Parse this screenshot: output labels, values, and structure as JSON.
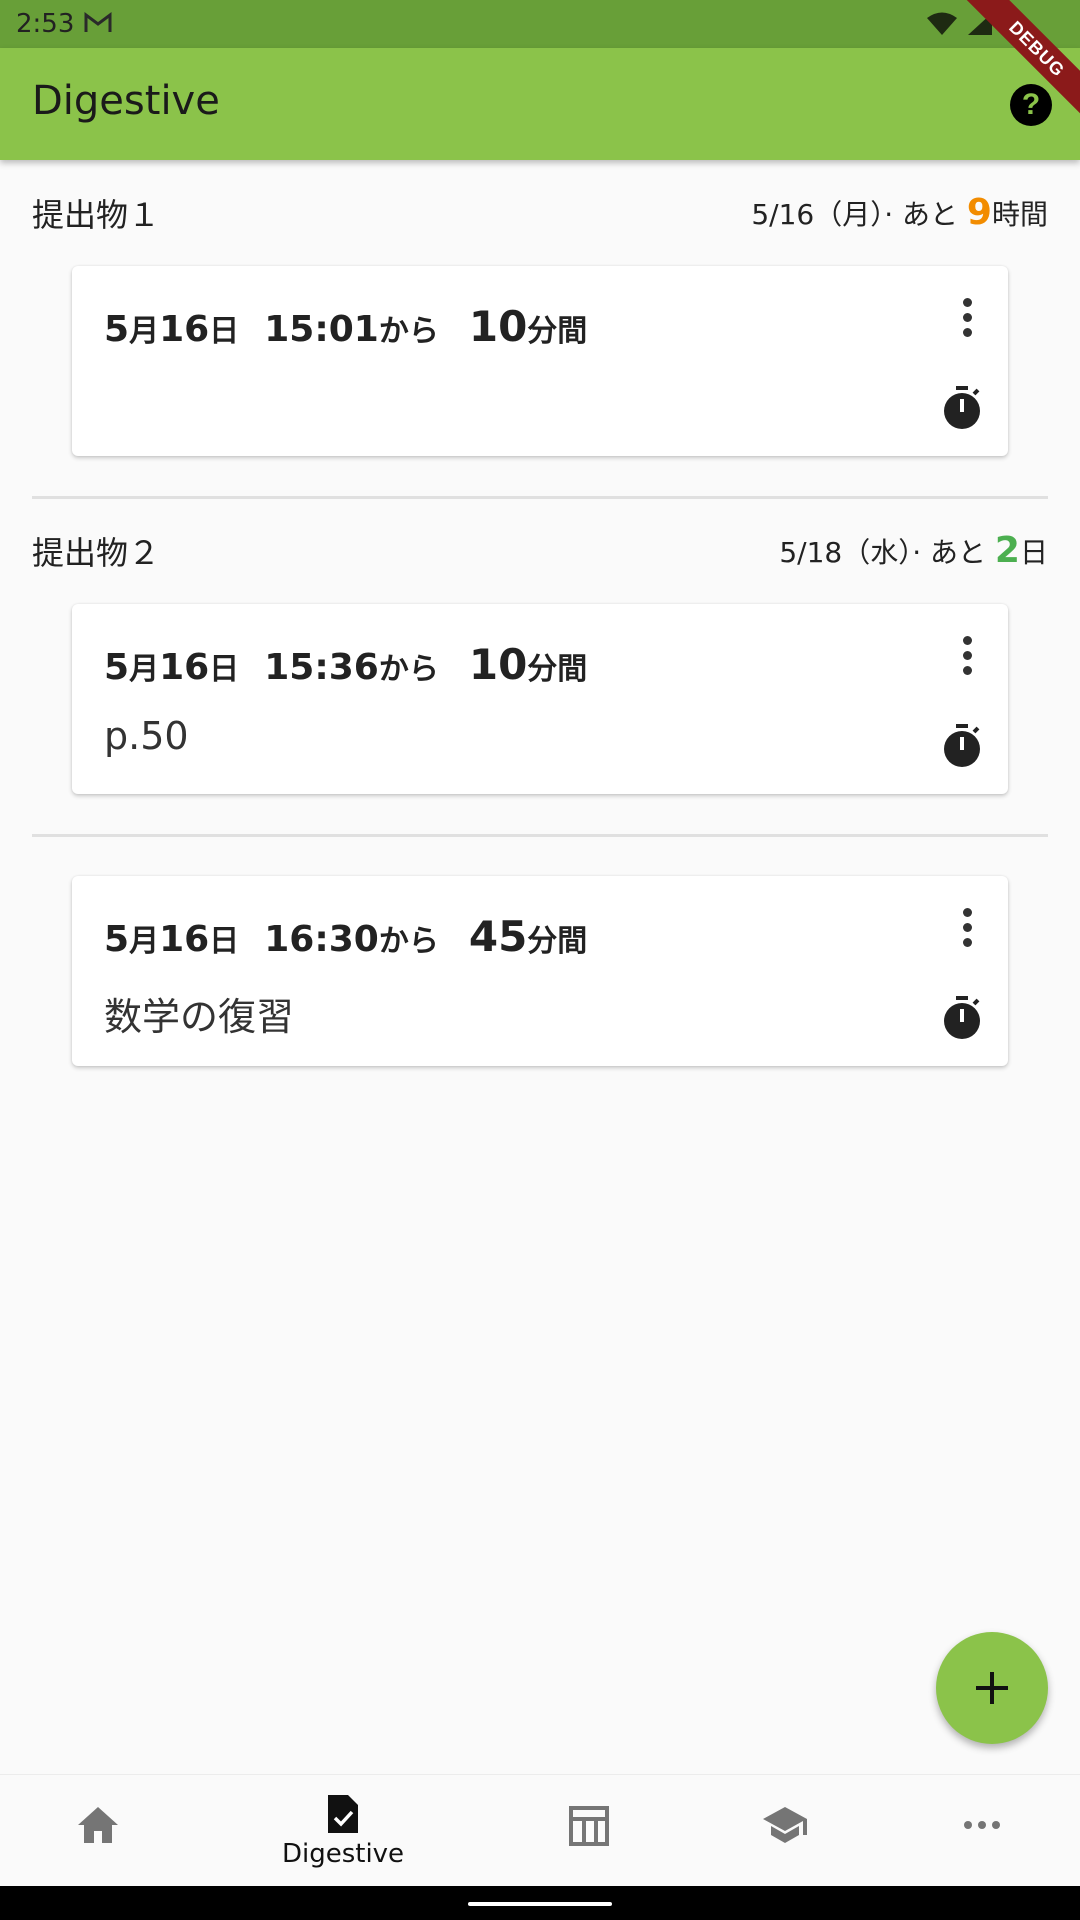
{
  "status_bar": {
    "time": "2:53"
  },
  "app_bar": {
    "title": "Digestive",
    "debug_label": "DEBUG"
  },
  "sections": [
    {
      "title": "提出物１",
      "due_prefix": "5/16（月）· あと ",
      "due_number": "9",
      "due_suffix": "時間",
      "due_color": "#f28c00"
    },
    {
      "title": "提出物２",
      "due_prefix": "5/18（水）· あと ",
      "due_number": "2",
      "due_suffix": "日",
      "due_color": "#4caf50"
    }
  ],
  "cards": [
    {
      "month": "5",
      "month_unit": "月",
      "day": "16",
      "day_unit": "日",
      "time": "15:01",
      "from": "から",
      "duration": "10",
      "duration_unit": "分間",
      "note": ""
    },
    {
      "month": "5",
      "month_unit": "月",
      "day": "16",
      "day_unit": "日",
      "time": "15:36",
      "from": "から",
      "duration": "10",
      "duration_unit": "分間",
      "note": "p.50"
    },
    {
      "month": "5",
      "month_unit": "月",
      "day": "16",
      "day_unit": "日",
      "time": "16:30",
      "from": "から",
      "duration": "45",
      "duration_unit": "分間",
      "note": "数学の復習"
    }
  ],
  "bottom_nav": {
    "active_label": "Digestive",
    "items": [
      "home-icon",
      "assignment-turned-in-icon",
      "table-icon",
      "school-icon",
      "more-horiz-icon"
    ]
  },
  "colors": {
    "primary": "#8bc34a",
    "status_bar": "#689f38",
    "accent_orange": "#f28c00",
    "accent_green": "#4caf50"
  }
}
